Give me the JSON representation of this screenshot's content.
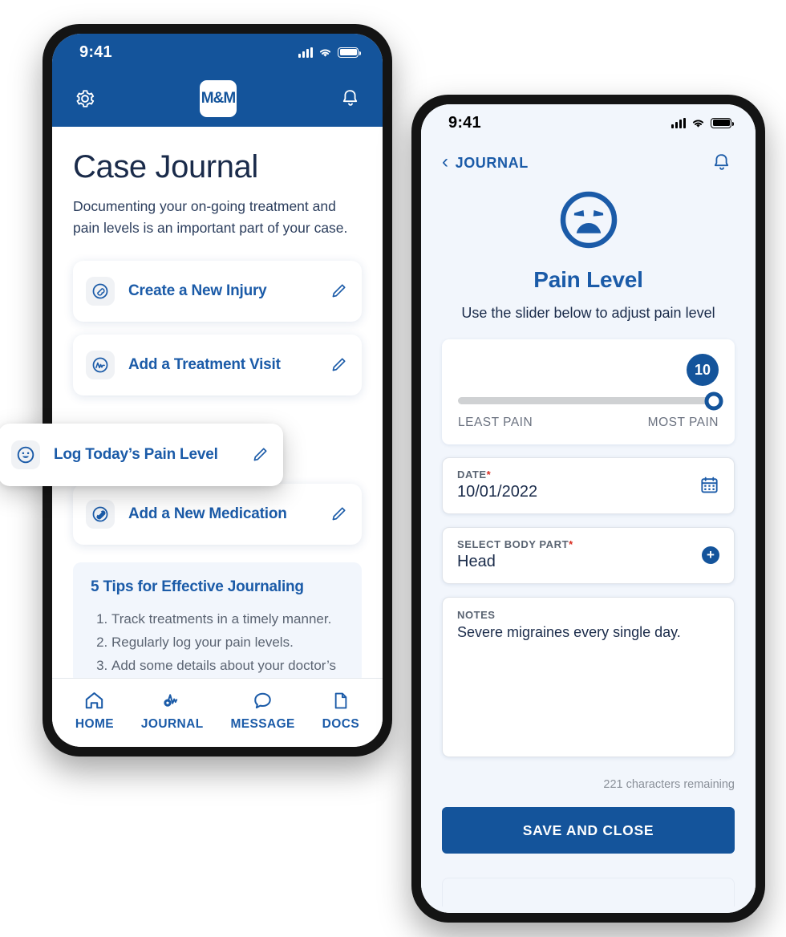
{
  "left_phone": {
    "status_bar": {
      "time": "9:41",
      "signal_icon": "cellular-bars-icon",
      "wifi_icon": "wifi-icon",
      "battery_icon": "battery-full-icon"
    },
    "app_bar": {
      "settings_icon": "gear-icon",
      "logo_text": "M&M",
      "notification_icon": "bell-icon"
    },
    "page_title": "Case Journal",
    "page_subtitle": "Documenting your on-going treatment and pain levels is an important part of your case.",
    "action_cards": [
      {
        "label": "Create a New Injury",
        "icon": "injury-bandage-icon",
        "edit_icon": "pencil-icon"
      },
      {
        "label": "Add a Treatment Visit",
        "icon": "heartbeat-monitor-icon",
        "edit_icon": "pencil-icon"
      },
      {
        "label": "Add a New Medication",
        "icon": "pill-capsule-icon",
        "edit_icon": "pencil-icon"
      }
    ],
    "floating_card": {
      "label": "Log Today’s Pain Level",
      "icon": "smiley-face-icon",
      "edit_icon": "pencil-icon"
    },
    "tips": {
      "title": "5 Tips for Effective Journaling",
      "items": [
        "Track treatments in a timely manner.",
        "Regularly log your pain levels.",
        "Add some details about your doctor’s"
      ]
    },
    "tab_bar": [
      {
        "label": "HOME",
        "icon": "home-icon"
      },
      {
        "label": "JOURNAL",
        "icon": "journal-pulse-icon"
      },
      {
        "label": "MESSAGE",
        "icon": "chat-bubble-icon"
      },
      {
        "label": "DOCS",
        "icon": "document-icon"
      }
    ]
  },
  "right_phone": {
    "status_bar": {
      "time": "9:41",
      "signal_icon": "cellular-bars-icon",
      "wifi_icon": "wifi-icon",
      "battery_icon": "battery-full-icon"
    },
    "nav": {
      "back_label": "JOURNAL",
      "back_icon": "chevron-left-icon",
      "notification_icon": "bell-icon"
    },
    "hero": {
      "face_icon": "angry-face-icon",
      "title": "Pain Level",
      "caption": "Use the slider below to adjust pain level"
    },
    "slider": {
      "value": "10",
      "min_label": "LEAST PAIN",
      "max_label": "MOST PAIN",
      "percent": 100
    },
    "fields": [
      {
        "label": "DATE",
        "required": "*",
        "value": "10/01/2022",
        "icon": "calendar-icon"
      },
      {
        "label": "SELECT BODY PART",
        "required": "*",
        "value": "Head",
        "icon": "plus-circle-icon"
      }
    ],
    "notes": {
      "label": "NOTES",
      "value": "Severe migraines every single day.",
      "counter": "221 characters remaining"
    },
    "save_button": "SAVE AND CLOSE"
  },
  "colors": {
    "brand_blue": "#14549B",
    "link_blue": "#1B5BA8",
    "dark_navy": "#1A2B4A",
    "light_blue_bg": "#F2F6FC",
    "required_red": "#D92D20",
    "track_gray": "#CFD1D3"
  }
}
